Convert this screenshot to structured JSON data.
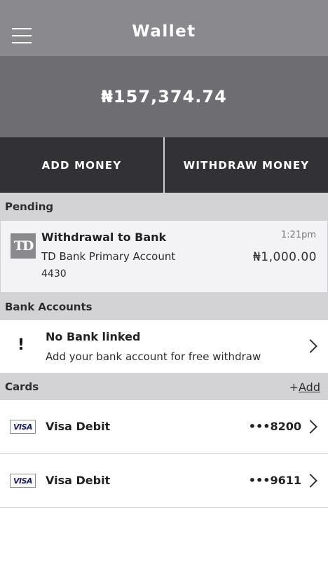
{
  "header": {
    "title": "Wallet",
    "menu_icon": "hamburger-menu-icon"
  },
  "balance": {
    "amount": "₦157,374.74"
  },
  "actions": {
    "add_money": "ADD MONEY",
    "withdraw_money": "WITHDRAW MONEY"
  },
  "pending": {
    "section_label": "Pending",
    "item": {
      "logo_text": "TD",
      "title": "Withdrawal to Bank",
      "account": "TD Bank Primary Account",
      "account_number": "4430",
      "time": "1:21pm",
      "amount": "₦1,000.00"
    }
  },
  "bank_accounts": {
    "section_label": "Bank Accounts",
    "empty_title": "No Bank linked",
    "empty_sub": "Add your bank account for free withdraw",
    "icon": "!"
  },
  "cards": {
    "section_label": "Cards",
    "add_prefix": "+",
    "add_label": "Add",
    "items": [
      {
        "brand": "VISA",
        "name": "Visa Debit",
        "last4": "•••8200"
      },
      {
        "brand": "VISA",
        "name": "Visa Debit",
        "last4": "•••9611"
      }
    ]
  },
  "colors": {
    "header_bg": "#8a898e",
    "balance_bg": "#6e6d71",
    "actions_bg": "#323236",
    "section_bg": "#d3d3d6",
    "visa_blue": "#1a1f71"
  }
}
